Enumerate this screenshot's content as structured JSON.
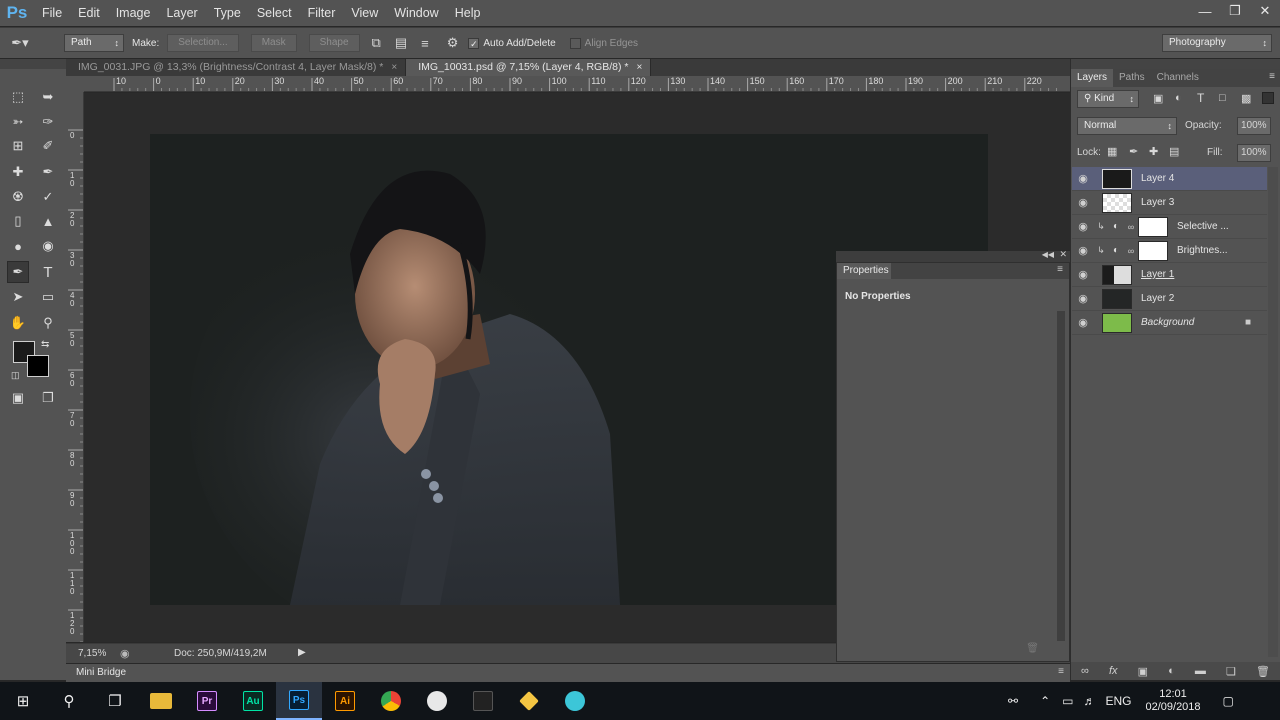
{
  "app": {
    "logo": "Ps"
  },
  "menu": [
    "File",
    "Edit",
    "Image",
    "Layer",
    "Type",
    "Select",
    "Filter",
    "View",
    "Window",
    "Help"
  ],
  "options": {
    "tool_mode": "Path",
    "make_label": "Make:",
    "selection_btn": "Selection...",
    "mask_btn": "Mask",
    "shape_btn": "Shape",
    "auto_add_delete": "Auto Add/Delete",
    "align_edges": "Align Edges",
    "workspace": "Photography"
  },
  "tabs": [
    {
      "label": "IMG_0031.JPG @ 13,3% (Brightness/Contrast 4, Layer Mask/8) *",
      "close": "×"
    },
    {
      "label": "IMG_10031.psd @ 7,15% (Layer 4, RGB/8) *",
      "close": "×"
    }
  ],
  "ruler_top": [
    "10",
    "0",
    "10",
    "20",
    "30",
    "40",
    "50",
    "60",
    "70",
    "80",
    "90",
    "100",
    "110",
    "120",
    "130",
    "140",
    "150",
    "160",
    "170",
    "180",
    "190",
    "200",
    "210",
    "220"
  ],
  "ruler_left": [
    "0",
    "1 0",
    "2 0",
    "3 0",
    "4 0",
    "5 0",
    "6 0",
    "7 0",
    "8 0",
    "9 0",
    "1 0 0",
    "1 1 0",
    "1 2 0"
  ],
  "status": {
    "zoom": "7,15%",
    "doc": "Doc: 250,9M/419,2M"
  },
  "mini_bridge": "Mini Bridge",
  "properties": {
    "tab": "Properties",
    "content": "No Properties"
  },
  "layers_panel": {
    "tabs": [
      "Layers",
      "Paths",
      "Channels"
    ],
    "filter": "Kind",
    "blend_mode": "Normal",
    "opacity_label": "Opacity:",
    "opacity": "100%",
    "lock_label": "Lock:",
    "fill_label": "Fill:",
    "fill": "100%",
    "layers": [
      {
        "name": "Layer 4",
        "selected": true
      },
      {
        "name": "Layer 3"
      },
      {
        "name": "Selective ..."
      },
      {
        "name": "Brightnes..."
      },
      {
        "name": "Layer 1"
      },
      {
        "name": "Layer 2"
      },
      {
        "name": "Background"
      }
    ]
  },
  "taskbar": {
    "lang": "ENG",
    "time": "12:01",
    "date": "02/09/2018"
  },
  "colors": {
    "accent": "#5fb4f0",
    "selected_layer": "#5a5f7a",
    "panel": "#535353"
  }
}
